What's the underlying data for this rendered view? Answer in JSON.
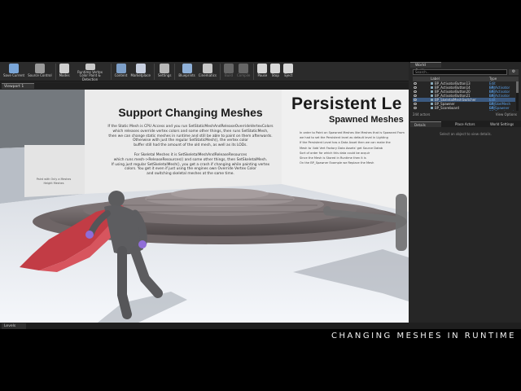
{
  "toolbar": {
    "items": [
      {
        "label": "Save Current",
        "icon": "save-icon",
        "color": "#7aa6d8"
      },
      {
        "label": "Source Control",
        "icon": "source-control-icon",
        "color": "#9a9a9a"
      },
      {
        "label": "Modes",
        "icon": "modes-icon",
        "color": "#d0d0d0"
      },
      {
        "label": "Runtime Vertex Color Paint & Detection",
        "icon": "paint-icon",
        "color": "#c8c8c8"
      },
      {
        "label": "Content",
        "icon": "content-icon",
        "color": "#7d9fc8"
      },
      {
        "label": "Marketplace",
        "icon": "marketplace-icon",
        "color": "#c8d0e0"
      },
      {
        "label": "Settings",
        "icon": "gear-icon",
        "color": "#b8b8b8"
      },
      {
        "label": "Blueprints",
        "icon": "blueprints-icon",
        "color": "#8fb0d8"
      },
      {
        "label": "Cinematics",
        "icon": "cinematics-icon",
        "color": "#c8c8c8"
      },
      {
        "label": "Build",
        "icon": "build-icon",
        "color": "#666666"
      },
      {
        "label": "Compile",
        "icon": "compile-icon",
        "color": "#666666"
      },
      {
        "label": "Pause",
        "icon": "pause-icon",
        "color": "#d8d8d8"
      },
      {
        "label": "Stop",
        "icon": "stop-icon",
        "color": "#d8d8d8"
      },
      {
        "label": "Eject",
        "icon": "eject-icon",
        "color": "#d8d8d8"
      }
    ]
  },
  "viewport": {
    "tab_label": "Viewport 1",
    "left_sign": {
      "title": "Support Changing Meshes",
      "para1": [
        "If the Static Mesh is CPU Access and you run SetStaticMeshAndReleaseOverrideVertexColors",
        "which releases override vertex colors and some other things, then runs SetStaticMesh,",
        "then we can change static meshes in runtime and still be able to paint on them afterwards.",
        "Otherwise with just the regular SetStaticMesh(), the vertex color",
        "buffer still had the amount of the old mesh, as well as its LODs."
      ],
      "para2": [
        "For Skeletal Meshes it is SetSkeletalMeshAndReleaseResources",
        "which runs mesh->ReleaseResources() and some other things, then SetSkeletalMesh.",
        "If using just regular SetSkeletalMesh(), you get a crash if changing while painting vertex",
        "colors. You get it even if just using the engines own Override Vertex Color",
        "and switching skeletal meshes at the same time."
      ]
    },
    "right_sign": {
      "title": "Persistent Le",
      "subtitle": "Spawned Meshes",
      "lines": [
        "In order to Paint on Spawned Meshes like Meshes that is Spawned From",
        "we had to set the Persistent level as default level in Lighting",
        "If the Persistent Level has a Data Asset then we can make the",
        "Mesh to 'Add Vert Factory Data Assets' get Source Datab",
        "Sort of order for which this data could be acquir",
        "Since the Mesh is Stored in Runtime then it is",
        "On the BP_Spawner Example we Replace the Mesh"
      ]
    },
    "wall_sign": {
      "lines": [
        "Paint with Only a Meshes",
        "Height Meshes"
      ]
    }
  },
  "outliner": {
    "tab_label": "World Outliner",
    "search_placeholder": "Search...",
    "col_label": "Label",
    "col_type": "Type",
    "rows": [
      {
        "name": "BP_ActivatorButton13",
        "type": "Edit BP_Activator"
      },
      {
        "name": "BP_ActivatorButton14",
        "type": "Edit BP_Activator"
      },
      {
        "name": "BP_ActivatorButton20",
        "type": "Edit BP_Activator"
      },
      {
        "name": "BP_ActivatorButton21",
        "type": "Edit BP_Activator"
      },
      {
        "name": "BP_SkeletalMeshSwitcher",
        "type": "Edit BP_SkelMesh"
      },
      {
        "name": "BP_Spawner",
        "type": "Edit BP_Spawner"
      },
      {
        "name": "BP_Scoreboard",
        "type": "Edit BP_Scoreboard"
      }
    ],
    "actor_count": "244 actors",
    "view_options": "View Options"
  },
  "details": {
    "tabs": [
      "Details",
      "Place Actors",
      "World Settings"
    ],
    "empty_message": "Select an object to view details."
  },
  "levels": {
    "tab_label": "Levels"
  },
  "caption": "CHANGING MESHES IN RUNTIME"
}
